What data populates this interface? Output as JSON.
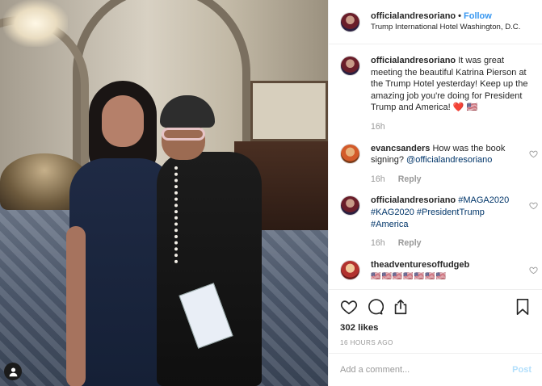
{
  "photo": {
    "alt_icon": "user-tag-icon"
  },
  "header": {
    "username": "officialandresoriano",
    "separator": "•",
    "follow_label": "Follow",
    "location": "Trump International Hotel Washington, D.C."
  },
  "comments": [
    {
      "username": "officialandresoriano",
      "text": "It was great meeting the beautiful Katrina Pierson at the Trump Hotel yesterday! Keep up the amazing job you're doing for President Trump and America! ❤️ 🇺🇸",
      "time": "16h",
      "reply": ""
    },
    {
      "username": "evancsanders",
      "text": "How was the book signing?",
      "mention": "@officialandresoriano",
      "time": "16h",
      "reply": "Reply"
    },
    {
      "username": "officialandresoriano",
      "tags": [
        "#MAGA2020",
        "#KAG2020",
        "#PresidentTrump",
        "#America"
      ],
      "time": "16h",
      "reply": "Reply"
    },
    {
      "username": "theadventuresoffudgeb",
      "text": "🇺🇸🇺🇸🇺🇸🇺🇸🇺🇸🇺🇸🇺🇸"
    }
  ],
  "actions": {
    "icons": [
      "heart-icon",
      "comment-icon",
      "share-icon",
      "bookmark-icon"
    ],
    "likes": "302 likes",
    "time": "16 HOURS AGO"
  },
  "add_comment": {
    "placeholder": "Add a comment...",
    "post_label": "Post"
  },
  "colors": {
    "link": "#3897f0",
    "tag": "#003569",
    "muted": "#999999",
    "post_disabled": "#b2dffc"
  }
}
